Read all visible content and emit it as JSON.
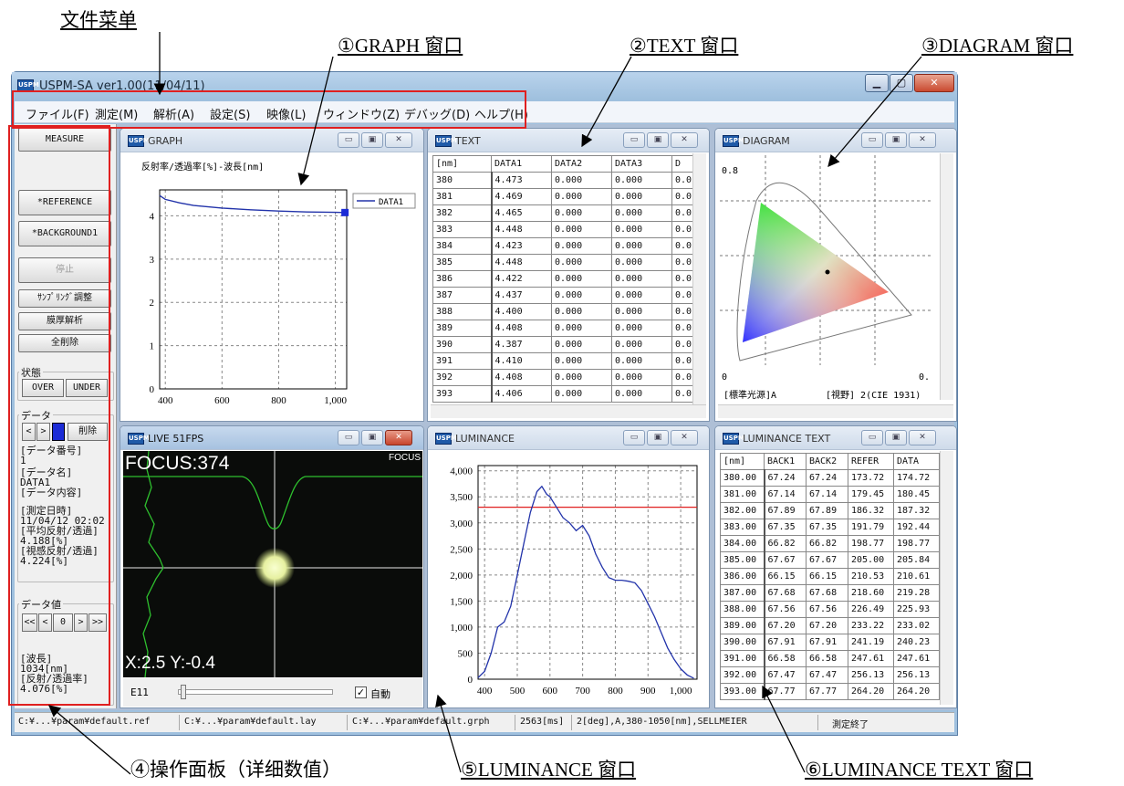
{
  "annotations": {
    "file_menu": "文件菜单",
    "graph_window": "①GRAPH 窗口",
    "text_window": "②TEXT 窗口",
    "diagram_window": "③DIAGRAM 窗口",
    "operation_panel": "④操作面板（详细数值）",
    "luminance_window": "⑤LUMINANCE 窗口",
    "luminance_text_window": "⑥LUMINANCE TEXT 窗口"
  },
  "app": {
    "title": "USPM-SA ver1.00(11/04/11)",
    "menu": [
      "ファイル(F)",
      "測定(M)",
      "解析(A)",
      "設定(S)",
      "映像(L)",
      "ウィンドウ(Z)",
      "デバッグ(D)",
      "ヘルプ(H)"
    ]
  },
  "panel": {
    "measure": "MEASURE",
    "reference": "*REFERENCE",
    "background": "*BACKGROUND1",
    "stop": "停止",
    "sampling": "ｻﾝﾌﾟﾘﾝｸﾞ調整",
    "thickness": "膜厚解析",
    "clear_all": "全削除",
    "state_label": "状態",
    "over": "OVER",
    "under": "UNDER",
    "data_label": "データ",
    "prev": "<",
    "next": ">",
    "delete": "削除",
    "data_number_label": "[データ番号]",
    "data_number": "1",
    "data_name_label": "[データ名]",
    "data_name": "DATA1",
    "data_content_label": "[データ内容]",
    "measure_date_label": "[測定日時]",
    "measure_date": " 11/04/12 02:02",
    "avg_label": "[平均反射/透過]",
    "avg_value": " 4.188[%]",
    "visual_label": "[視感反射/透過]",
    "visual_value": " 4.224[%]",
    "datavalue_label": "データ値",
    "nav_first": "<<",
    "nav_prev": "<",
    "nav_center": "0",
    "nav_next": ">",
    "nav_last": ">>",
    "wavelength_label": "[波長]",
    "wavelength_value": " 1034[nm]",
    "reflect_label": "[反射/透過率]",
    "reflect_value": " 4.076[%]"
  },
  "graph": {
    "title": "GRAPH",
    "chart_data": {
      "type": "line",
      "title": "反射率/透過率[%]-波長[nm]",
      "x": [
        380,
        400,
        450,
        500,
        600,
        700,
        800,
        900,
        1000,
        1034
      ],
      "series": [
        {
          "name": "DATA1",
          "values": [
            4.47,
            4.38,
            4.3,
            4.24,
            4.18,
            4.14,
            4.11,
            4.09,
            4.08,
            4.076
          ]
        }
      ],
      "xlim": [
        380,
        1040
      ],
      "ylim": [
        0,
        4.6
      ],
      "xticks": [
        "400",
        "600",
        "800",
        "1,000"
      ],
      "yticks": [
        "0",
        "1",
        "2",
        "3",
        "4"
      ],
      "legend": "top-right",
      "grid": true
    }
  },
  "text": {
    "title": "TEXT",
    "headers": [
      "[nm]",
      "DATA1",
      "DATA2",
      "DATA3",
      "D"
    ],
    "rows": [
      [
        "380",
        "4.473",
        "0.000",
        "0.000",
        "0.0"
      ],
      [
        "381",
        "4.469",
        "0.000",
        "0.000",
        "0.0"
      ],
      [
        "382",
        "4.465",
        "0.000",
        "0.000",
        "0.0"
      ],
      [
        "383",
        "4.448",
        "0.000",
        "0.000",
        "0.0"
      ],
      [
        "384",
        "4.423",
        "0.000",
        "0.000",
        "0.0"
      ],
      [
        "385",
        "4.448",
        "0.000",
        "0.000",
        "0.0"
      ],
      [
        "386",
        "4.422",
        "0.000",
        "0.000",
        "0.0"
      ],
      [
        "387",
        "4.437",
        "0.000",
        "0.000",
        "0.0"
      ],
      [
        "388",
        "4.400",
        "0.000",
        "0.000",
        "0.0"
      ],
      [
        "389",
        "4.408",
        "0.000",
        "0.000",
        "0.0"
      ],
      [
        "390",
        "4.387",
        "0.000",
        "0.000",
        "0.0"
      ],
      [
        "391",
        "4.410",
        "0.000",
        "0.000",
        "0.0"
      ],
      [
        "392",
        "4.408",
        "0.000",
        "0.000",
        "0.0"
      ],
      [
        "393",
        "4.406",
        "0.000",
        "0.000",
        "0.0"
      ]
    ]
  },
  "diagram": {
    "title": "DIAGRAM",
    "tick_08": "0.8",
    "tick_0": "0",
    "tick_right": "0.",
    "light_source": "[標準光源]A",
    "view": "[視野] 2(CIE 1931)"
  },
  "live": {
    "title": "LIVE 51FPS",
    "focus_value": "FOCUS:374",
    "focus_label": "FOCUS",
    "xy": "X:2.5 Y:-0.4",
    "exposure": "E11",
    "auto": "自動"
  },
  "luminance": {
    "title": "LUMINANCE",
    "chart_data": {
      "type": "line",
      "x": [
        380,
        400,
        420,
        440,
        460,
        480,
        500,
        520,
        540,
        560,
        575,
        590,
        600,
        620,
        640,
        660,
        680,
        700,
        720,
        740,
        760,
        780,
        800,
        820,
        840,
        860,
        880,
        900,
        920,
        940,
        960,
        980,
        1000,
        1020,
        1040
      ],
      "values": [
        30,
        150,
        500,
        1000,
        1100,
        1400,
        2000,
        2600,
        3200,
        3600,
        3700,
        3550,
        3500,
        3300,
        3100,
        3000,
        2850,
        2950,
        2750,
        2400,
        2150,
        1950,
        1900,
        1900,
        1880,
        1850,
        1700,
        1450,
        1200,
        900,
        600,
        380,
        200,
        80,
        20
      ],
      "threshold": 3300,
      "xlim": [
        380,
        1050
      ],
      "ylim": [
        0,
        4100
      ],
      "xticks": [
        "400",
        "500",
        "600",
        "700",
        "800",
        "900",
        "1,000"
      ],
      "yticks": [
        "0",
        "500",
        "1,000",
        "1,500",
        "2,000",
        "2,500",
        "3,000",
        "3,500",
        "4,000"
      ],
      "grid": true
    }
  },
  "lumtext": {
    "title": "LUMINANCE TEXT",
    "headers": [
      "[nm]",
      "BACK1",
      "BACK2",
      "REFER",
      "DATA"
    ],
    "rows": [
      [
        "380.00",
        "67.24",
        "67.24",
        "173.72",
        "174.72"
      ],
      [
        "381.00",
        "67.14",
        "67.14",
        "179.45",
        "180.45"
      ],
      [
        "382.00",
        "67.89",
        "67.89",
        "186.32",
        "187.32"
      ],
      [
        "383.00",
        "67.35",
        "67.35",
        "191.79",
        "192.44"
      ],
      [
        "384.00",
        "66.82",
        "66.82",
        "198.77",
        "198.77"
      ],
      [
        "385.00",
        "67.67",
        "67.67",
        "205.00",
        "205.84"
      ],
      [
        "386.00",
        "66.15",
        "66.15",
        "210.53",
        "210.61"
      ],
      [
        "387.00",
        "67.68",
        "67.68",
        "218.60",
        "219.28"
      ],
      [
        "388.00",
        "67.56",
        "67.56",
        "226.49",
        "225.93"
      ],
      [
        "389.00",
        "67.20",
        "67.20",
        "233.22",
        "233.02"
      ],
      [
        "390.00",
        "67.91",
        "67.91",
        "241.19",
        "240.23"
      ],
      [
        "391.00",
        "66.58",
        "66.58",
        "247.61",
        "247.61"
      ],
      [
        "392.00",
        "67.47",
        "67.47",
        "256.13",
        "256.13"
      ],
      [
        "393.00",
        "67.77",
        "67.77",
        "264.20",
        "264.20"
      ]
    ]
  },
  "status": {
    "ref": "C:¥...¥param¥default.ref",
    "lay": "C:¥...¥param¥default.lay",
    "grph": "C:¥...¥param¥default.grph",
    "time": "2563[ms]",
    "cond": "2[deg],A,380-1050[nm],SELLMEIER",
    "state": "測定終了"
  },
  "colors": {
    "highlight": "#e02020",
    "series": "#2233aa",
    "threshold": "#e02020",
    "camera_line": "#2ec02e"
  }
}
